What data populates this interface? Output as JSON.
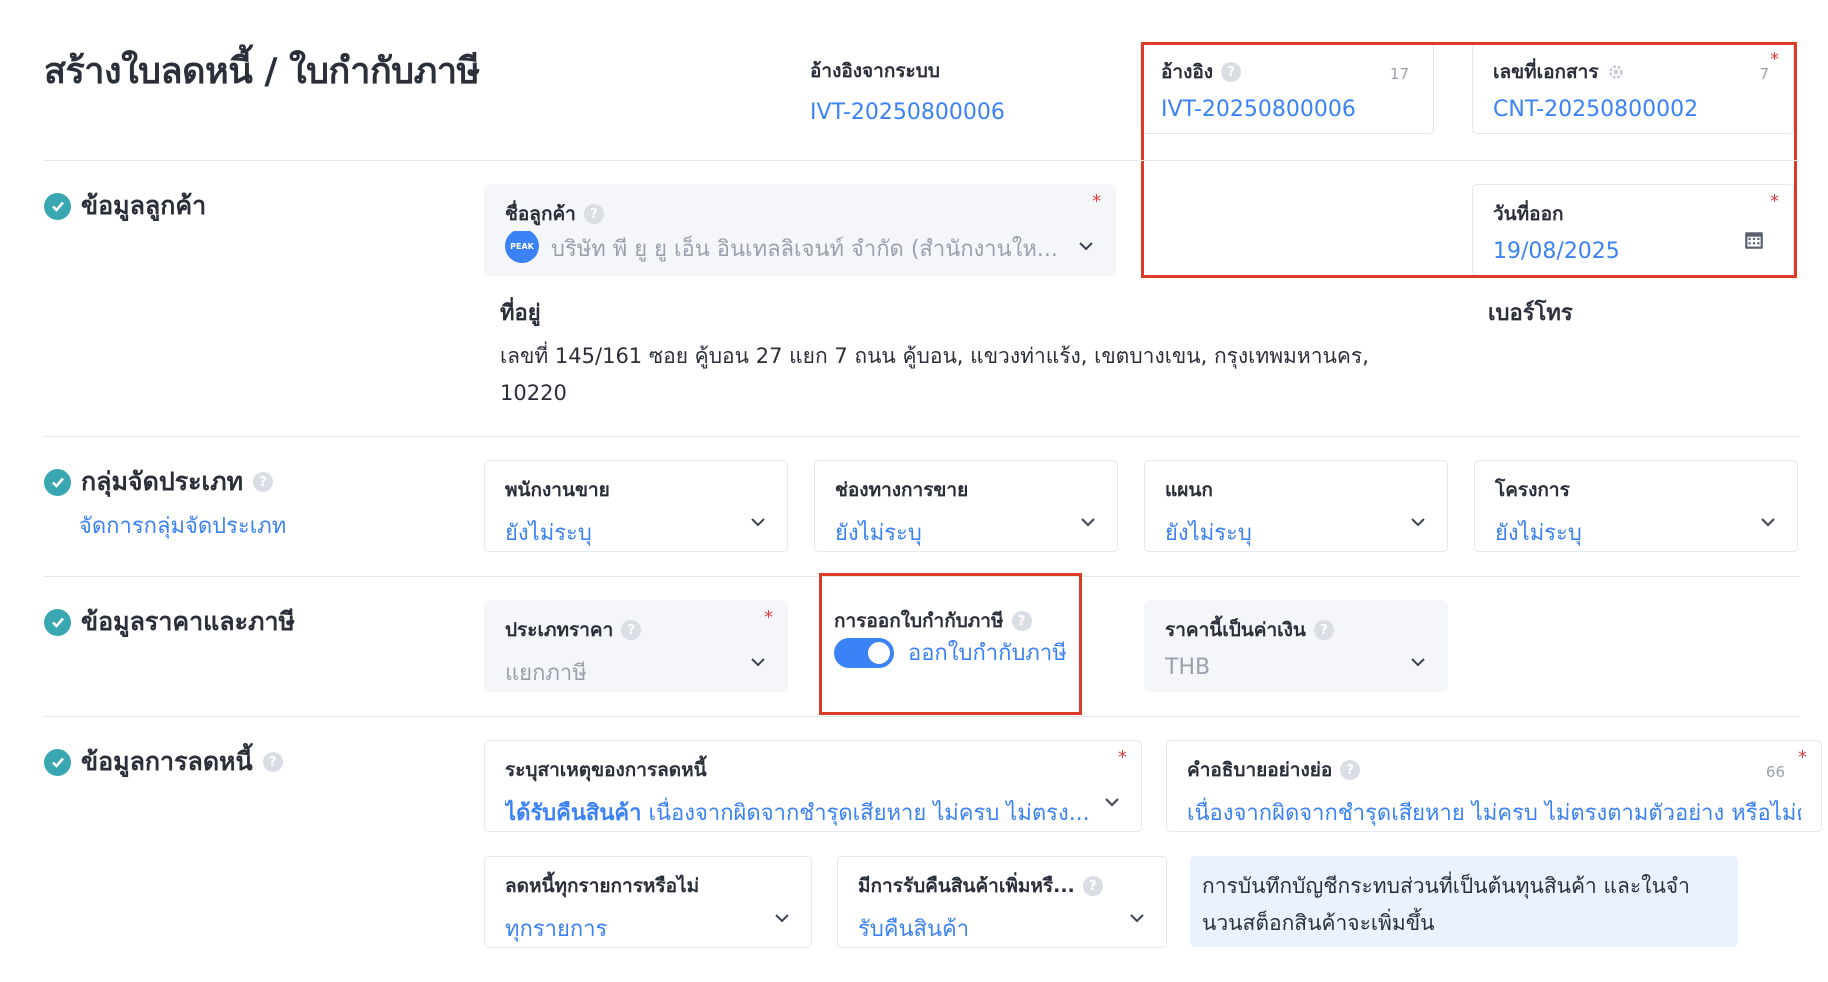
{
  "page": {
    "title": "สร้างใบลดหนี้ / ใบกำกับภาษี"
  },
  "header": {
    "system_ref_label": "อ้างอิงจากระบบ",
    "system_ref_value": "IVT-20250800006",
    "reference": {
      "label": "อ้างอิง",
      "value": "IVT-20250800006",
      "counter": "17"
    },
    "doc_number": {
      "label": "เลขที่เอกสาร",
      "value": "CNT-20250800002",
      "counter": "7"
    },
    "issue_date": {
      "label": "วันที่ออก",
      "value": "19/08/2025"
    }
  },
  "customer_section": {
    "title": "ข้อมูลลูกค้า",
    "customer_label": "ชื่อลูกค้า",
    "customer_avatar": "PEAK",
    "customer_value": "บริษัท พี ยู ยู เอ็น อินเทลลิเจนท์ จำกัด (สำนักงานให...",
    "address_label": "ที่อยู่",
    "address_line1": "เลขที่ 145/161 ซอย คู้บอน 27 แยก 7 ถนน คู้บอน, แขวงท่าแร้ง, เขตบางเขน, กรุงเทพมหานคร,",
    "address_line2": "10220",
    "phone_label": "เบอร์โทร"
  },
  "category_section": {
    "title": "กลุ่มจัดประเภท",
    "manage_link": "จัดการกลุ่มจัดประเภท",
    "fields": [
      {
        "label": "พนักงานขาย",
        "value": "ยังไม่ระบุ"
      },
      {
        "label": "ช่องทางการขาย",
        "value": "ยังไม่ระบุ"
      },
      {
        "label": "แผนก",
        "value": "ยังไม่ระบุ"
      },
      {
        "label": "โครงการ",
        "value": "ยังไม่ระบุ"
      }
    ]
  },
  "price_section": {
    "title": "ข้อมูลราคาและภาษี",
    "price_type_label": "ประเภทราคา",
    "price_type_value": "แยกภาษี",
    "tax_invoice_label": "การออกใบกำกับภาษี",
    "tax_invoice_toggle_label": "ออกใบกำกับภาษี",
    "tax_invoice_enabled": true,
    "currency_label": "ราคานี้เป็นค่าเงิน",
    "currency_value": "THB"
  },
  "credit_section": {
    "title": "ข้อมูลการลดหนี้",
    "reason_label": "ระบุสาเหตุของการลดหนี้",
    "reason_tag": "ได้รับคืนสินค้า",
    "reason_value": "เนื่องจากผิดจากชำรุดเสียหาย ไม่ครบ ไม่ตรง...",
    "desc_label": "คำอธิบายอย่างย่อ",
    "desc_counter": "66",
    "desc_value": "เนื่องจากผิดจากชำรุดเสียหาย ไม่ครบ ไม่ตรงตามตัวอย่าง หรือไม่ต",
    "all_items_label": "ลดหนี้ทุกรายการหรือไม่",
    "all_items_value": "ทุกรายการ",
    "return_label": "มีการรับคืนสินค้าเพิ่มหรื...",
    "return_value": "รับคืนสินค้า",
    "info_text": "การบันทึกบัญชีกระทบส่วนที่เป็นต้นทุนสินค้า และในจำนวนสต็อกสินค้าจะเพิ่มขึ้น",
    "info_line1": "การบันทึกบัญชีกระทบส่วนที่เป็นต้นทุนสินค้า และในจำ",
    "info_line2": "นวนสต็อกสินค้าจะเพิ่มขึ้น"
  },
  "colors": {
    "accent": "#3b82f6",
    "check": "#39a7b2",
    "highlight": "#dc3b26",
    "required": "#e53e3e"
  }
}
